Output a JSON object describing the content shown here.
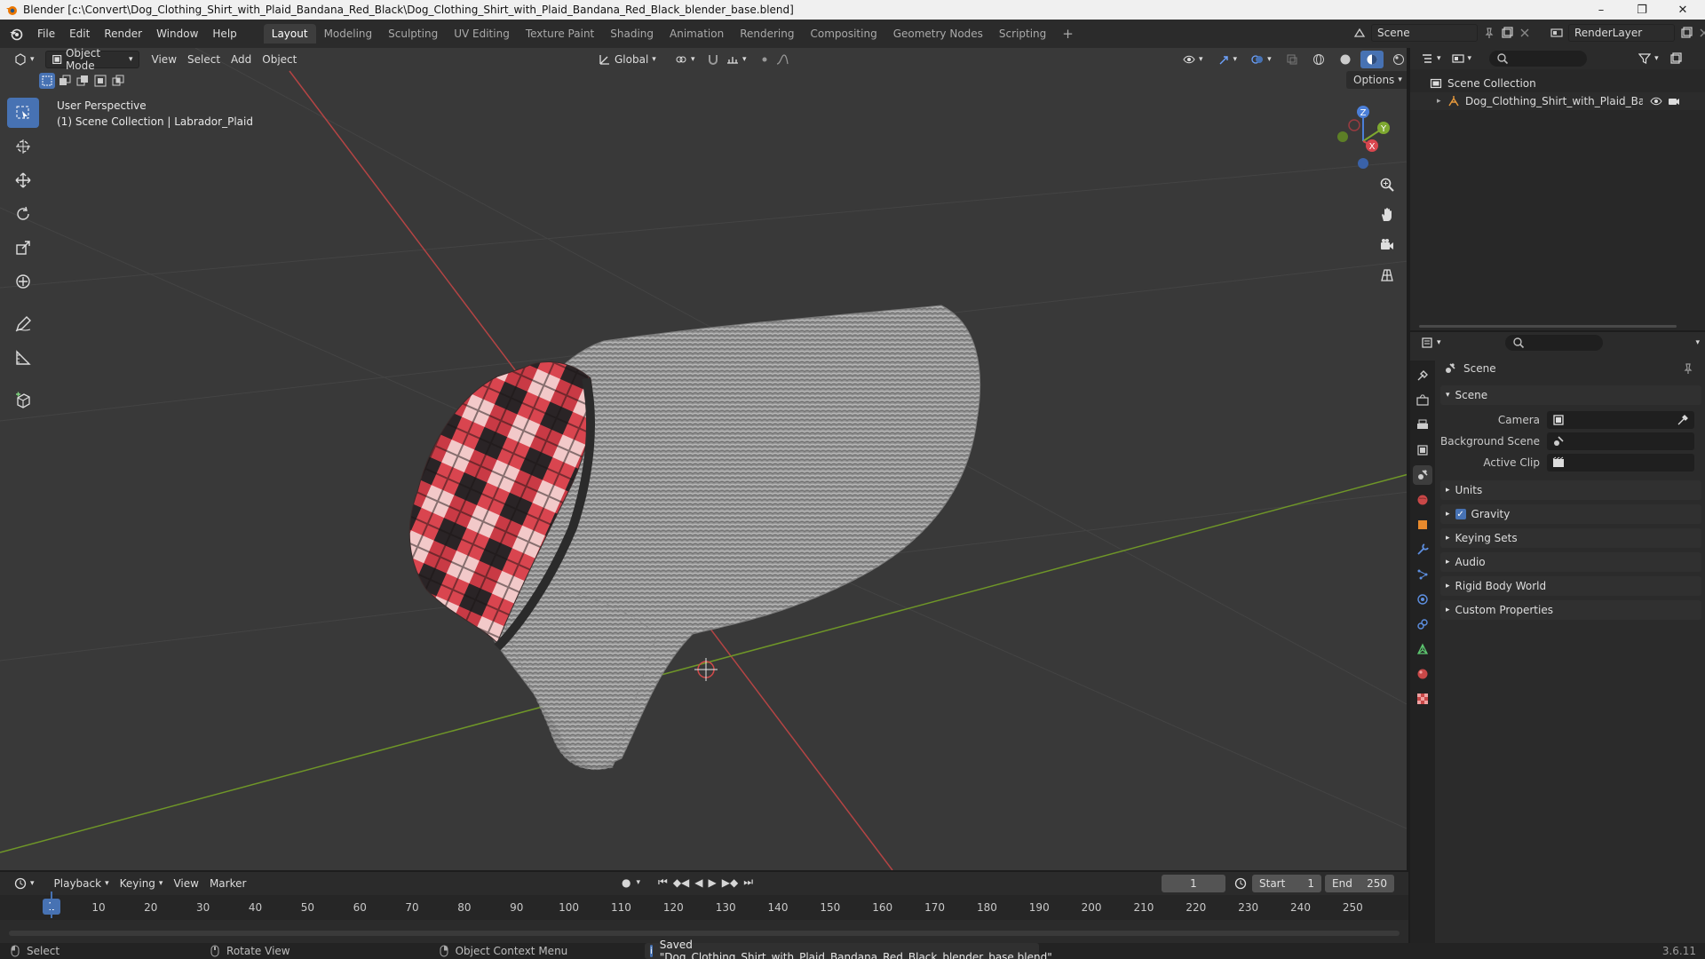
{
  "window": {
    "title": "Blender [c:\\Convert\\Dog_Clothing_Shirt_with_Plaid_Bandana_Red_Black\\Dog_Clothing_Shirt_with_Plaid_Bandana_Red_Black_blender_base.blend]",
    "minimize": "–",
    "maximize": "❐",
    "close": "✕"
  },
  "menu": {
    "items": [
      "File",
      "Edit",
      "Render",
      "Window",
      "Help"
    ],
    "workspaces": [
      "Layout",
      "Modeling",
      "Sculpting",
      "UV Editing",
      "Texture Paint",
      "Shading",
      "Animation",
      "Rendering",
      "Compositing",
      "Geometry Nodes",
      "Scripting"
    ],
    "active_workspace": "Layout",
    "add_workspace": "+",
    "scene_label": "Scene",
    "view_layer_label": "RenderLayer"
  },
  "viewport": {
    "mode": "Object Mode",
    "menus": [
      "View",
      "Select",
      "Add",
      "Object"
    ],
    "transform_orientation": "Global",
    "options_label": "Options",
    "perspective_label": "User Perspective",
    "context_label": "(1) Scene Collection | Labrador_Plaid",
    "gizmo_axes": {
      "x": "X",
      "y": "Y",
      "z": "Z"
    },
    "colors": {
      "background": "#393939",
      "x_axis": "#c24242",
      "y_axis": "#7a9e2c",
      "accent": "#4772b3"
    }
  },
  "timeline": {
    "menus": [
      "Playback",
      "Keying",
      "View",
      "Marker"
    ],
    "current_frame": "1",
    "start_label": "Start",
    "start_value": "1",
    "end_label": "End",
    "end_value": "250",
    "ruler_frames": [
      "10",
      "20",
      "30",
      "40",
      "50",
      "60",
      "70",
      "80",
      "90",
      "100",
      "110",
      "120",
      "130",
      "140",
      "150",
      "160",
      "170",
      "180",
      "190",
      "200",
      "210",
      "220",
      "230",
      "240",
      "250"
    ],
    "cursor_frame": "1"
  },
  "statusbar": {
    "select": "Select",
    "rotate": "Rotate View",
    "context_menu": "Object Context Menu",
    "message": "Saved \"Dog_Clothing_Shirt_with_Plaid_Bandana_Red_Black_blender_base.blend\"",
    "version": "3.6.11"
  },
  "outliner": {
    "root": "Scene Collection",
    "items": [
      {
        "label": "Dog_Clothing_Shirt_with_Plaid_Bandana"
      }
    ]
  },
  "properties": {
    "title": "Scene",
    "scene_panel": {
      "label": "Scene",
      "fields": [
        {
          "label": "Camera",
          "value": ""
        },
        {
          "label": "Background Scene",
          "value": ""
        },
        {
          "label": "Active Clip",
          "value": ""
        }
      ]
    },
    "panels": [
      "Units",
      "Gravity",
      "Keying Sets",
      "Audio",
      "Rigid Body World",
      "Custom Properties"
    ],
    "gravity_checked": true
  }
}
